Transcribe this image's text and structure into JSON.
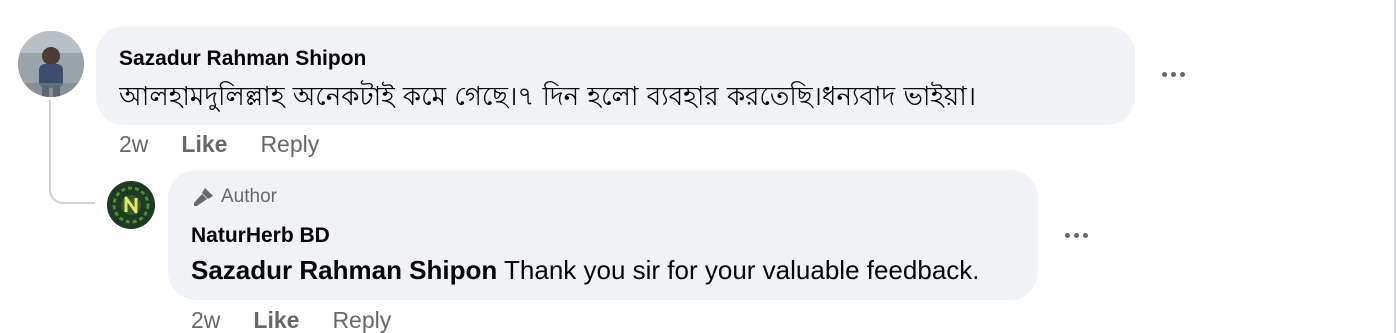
{
  "comment": {
    "author": "Sazadur Rahman Shipon",
    "text": "আলহামদুলিল্লাহ অনেকটাই কমে গেছে।৭ দিন হলো ব্যবহার করতেছি।ধন্যবাদ ভাইয়া।",
    "age": "2w",
    "like_label": "Like",
    "reply_label": "Reply"
  },
  "reply": {
    "badge": "Author",
    "author": "NaturHerb BD",
    "mention": "Sazadur Rahman Shipon",
    "text": " Thank you sir for your valuable feedback.",
    "age": "2w",
    "like_label": "Like",
    "reply_label": "Reply"
  },
  "icons": {
    "author_badge": "microphone-icon",
    "more": "more-options-icon"
  },
  "colors": {
    "bubble_bg": "#f0f2f5",
    "meta_text": "#65676b",
    "thread_line": "#ced0d4"
  }
}
